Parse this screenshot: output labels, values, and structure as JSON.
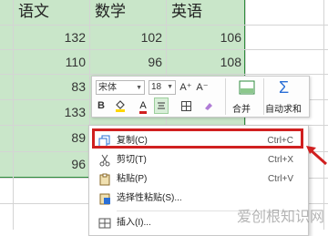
{
  "sheet": {
    "headers": [
      "语文",
      "数学",
      "英语"
    ],
    "rows": [
      [
        "",
        "132",
        "102",
        "106"
      ],
      [
        "",
        "110",
        "96",
        "108"
      ],
      [
        "",
        "83",
        "",
        ""
      ],
      [
        "",
        "133",
        "",
        ""
      ],
      [
        "",
        "89",
        "",
        ""
      ],
      [
        "",
        "96",
        "",
        ""
      ]
    ]
  },
  "toolbar": {
    "font_name": "宋体",
    "font_size": "18",
    "bold": "B",
    "font_color_letter": "A",
    "grow_font": "A⁺",
    "shrink_font": "A⁻",
    "merge_label": "合并",
    "autosum_label": "自动求和",
    "colors": {
      "accent_green": "#2e8b3d",
      "font_red": "#d02020",
      "fill_yellow": "#ffd800"
    }
  },
  "context_menu": {
    "items": [
      {
        "label": "复制(C)",
        "shortcut": "Ctrl+C",
        "icon": "copy-icon"
      },
      {
        "label": "剪切(T)",
        "shortcut": "Ctrl+X",
        "icon": "scissors-icon"
      },
      {
        "label": "粘贴(P)",
        "shortcut": "Ctrl+V",
        "icon": "paste-icon"
      },
      {
        "label": "选择性粘贴(S)...",
        "shortcut": "",
        "icon": "paste-special-icon"
      },
      {
        "label": "插入(I)...",
        "shortcut": "",
        "icon": "insert-icon"
      }
    ],
    "highlight_color": "#d02020"
  },
  "watermark": "爱创根知识网"
}
